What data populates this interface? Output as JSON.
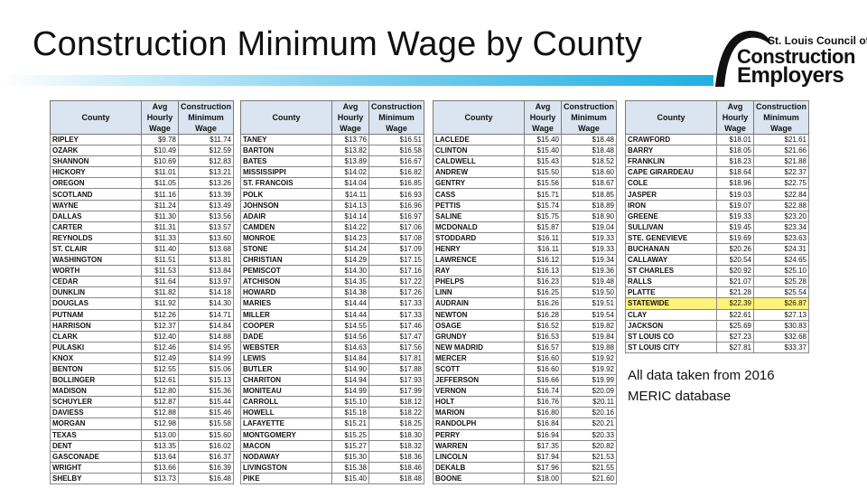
{
  "title": "Construction Minimum Wage by County",
  "logo": {
    "line1": "St. Louis Council of",
    "line2": "Construction",
    "line3": "Employers",
    "icon": "gateway-arch-icon"
  },
  "colors": {
    "band": "#1fb0e3",
    "header_fill": "#dbe5f1",
    "highlight": "#fff27a"
  },
  "table_headers": {
    "county": "County",
    "avg": "Avg Hourly Wage",
    "min": "Construction Minimum Wage"
  },
  "tables": [
    {
      "rows": [
        [
          "RIPLEY",
          "$9.78",
          "$11.74"
        ],
        [
          "OZARK",
          "$10.49",
          "$12.59"
        ],
        [
          "SHANNON",
          "$10.69",
          "$12.83"
        ],
        [
          "HICKORY",
          "$11.01",
          "$13.21"
        ],
        [
          "OREGON",
          "$11.05",
          "$13.26"
        ],
        [
          "SCOTLAND",
          "$11.16",
          "$13.39"
        ],
        [
          "WAYNE",
          "$11.24",
          "$13.49"
        ],
        [
          "DALLAS",
          "$11.30",
          "$13.56"
        ],
        [
          "CARTER",
          "$11.31",
          "$13.57"
        ],
        [
          "REYNOLDS",
          "$11.33",
          "$13.60"
        ],
        [
          "ST. CLAIR",
          "$11.40",
          "$13.68"
        ],
        [
          "WASHINGTON",
          "$11.51",
          "$13.81"
        ],
        [
          "WORTH",
          "$11.53",
          "$13.84"
        ],
        [
          "CEDAR",
          "$11.64",
          "$13.97"
        ],
        [
          "DUNKLIN",
          "$11.82",
          "$14.18"
        ],
        [
          "DOUGLAS",
          "$11.92",
          "$14.30"
        ],
        [
          "PUTNAM",
          "$12.26",
          "$14.71"
        ],
        [
          "HARRISON",
          "$12.37",
          "$14.84"
        ],
        [
          "CLARK",
          "$12.40",
          "$14.88"
        ],
        [
          "PULASKI",
          "$12.46",
          "$14.95"
        ],
        [
          "KNOX",
          "$12.49",
          "$14.99"
        ],
        [
          "BENTON",
          "$12.55",
          "$15.06"
        ],
        [
          "BOLLINGER",
          "$12.61",
          "$15.13"
        ],
        [
          "MADISON",
          "$12.80",
          "$15.36"
        ],
        [
          "SCHUYLER",
          "$12.87",
          "$15.44"
        ],
        [
          "DAVIESS",
          "$12.88",
          "$15.46"
        ],
        [
          "MORGAN",
          "$12.98",
          "$15.58"
        ],
        [
          "TEXAS",
          "$13.00",
          "$15.60"
        ],
        [
          "DENT",
          "$13.35",
          "$16.02"
        ],
        [
          "GASCONADE",
          "$13.64",
          "$16.37"
        ],
        [
          "WRIGHT",
          "$13.66",
          "$16.39"
        ],
        [
          "SHELBY",
          "$13.73",
          "$16.48"
        ]
      ]
    },
    {
      "rows": [
        [
          "TANEY",
          "$13.76",
          "$16.51"
        ],
        [
          "BARTON",
          "$13.82",
          "$16.58"
        ],
        [
          "BATES",
          "$13.89",
          "$16.67"
        ],
        [
          "MISSISSIPPI",
          "$14.02",
          "$16.82"
        ],
        [
          "ST. FRANCOIS",
          "$14.04",
          "$16.85"
        ],
        [
          "POLK",
          "$14.11",
          "$16.93"
        ],
        [
          "JOHNSON",
          "$14.13",
          "$16.96"
        ],
        [
          "ADAIR",
          "$14.14",
          "$16.97"
        ],
        [
          "CAMDEN",
          "$14.22",
          "$17.06"
        ],
        [
          "MONROE",
          "$14.23",
          "$17.08"
        ],
        [
          "STONE",
          "$14.24",
          "$17.09"
        ],
        [
          "CHRISTIAN",
          "$14.29",
          "$17.15"
        ],
        [
          "PEMISCOT",
          "$14.30",
          "$17.16"
        ],
        [
          "ATCHISON",
          "$14.35",
          "$17.22"
        ],
        [
          "HOWARD",
          "$14.38",
          "$17.26"
        ],
        [
          "MARIES",
          "$14.44",
          "$17.33"
        ],
        [
          "MILLER",
          "$14.44",
          "$17.33"
        ],
        [
          "COOPER",
          "$14.55",
          "$17.46"
        ],
        [
          "DADE",
          "$14.56",
          "$17.47"
        ],
        [
          "WEBSTER",
          "$14.63",
          "$17.56"
        ],
        [
          "LEWIS",
          "$14.84",
          "$17.81"
        ],
        [
          "BUTLER",
          "$14.90",
          "$17.88"
        ],
        [
          "CHARITON",
          "$14.94",
          "$17.93"
        ],
        [
          "MONITEAU",
          "$14.99",
          "$17.99"
        ],
        [
          "CARROLL",
          "$15.10",
          "$18.12"
        ],
        [
          "HOWELL",
          "$15.18",
          "$18.22"
        ],
        [
          "LAFAYETTE",
          "$15.21",
          "$18.25"
        ],
        [
          "MONTGOMERY",
          "$15.25",
          "$18.30"
        ],
        [
          "MACON",
          "$15.27",
          "$18.32"
        ],
        [
          "NODAWAY",
          "$15.30",
          "$18.36"
        ],
        [
          "LIVINGSTON",
          "$15.38",
          "$18.46"
        ],
        [
          "PIKE",
          "$15.40",
          "$18.48"
        ]
      ]
    },
    {
      "rows": [
        [
          "LACLEDE",
          "$15.40",
          "$18.48"
        ],
        [
          "CLINTON",
          "$15.40",
          "$18.48"
        ],
        [
          "CALDWELL",
          "$15.43",
          "$18.52"
        ],
        [
          "ANDREW",
          "$15.50",
          "$18.60"
        ],
        [
          "GENTRY",
          "$15.56",
          "$18.67"
        ],
        [
          "CASS",
          "$15.71",
          "$18.85"
        ],
        [
          "PETTIS",
          "$15.74",
          "$18.89"
        ],
        [
          "SALINE",
          "$15.75",
          "$18.90"
        ],
        [
          "MCDONALD",
          "$15.87",
          "$19.04"
        ],
        [
          "STODDARD",
          "$16.11",
          "$19.33"
        ],
        [
          "HENRY",
          "$16.11",
          "$19.33"
        ],
        [
          "LAWRENCE",
          "$16.12",
          "$19.34"
        ],
        [
          "RAY",
          "$16.13",
          "$19.36"
        ],
        [
          "PHELPS",
          "$16.23",
          "$19.48"
        ],
        [
          "LINN",
          "$16.25",
          "$19.50"
        ],
        [
          "AUDRAIN",
          "$16.26",
          "$19.51"
        ],
        [
          "NEWTON",
          "$16.28",
          "$19.54"
        ],
        [
          "OSAGE",
          "$16.52",
          "$19.82"
        ],
        [
          "GRUNDY",
          "$16.53",
          "$19.84"
        ],
        [
          "NEW MADRID",
          "$16.57",
          "$19.88"
        ],
        [
          "MERCER",
          "$16.60",
          "$19.92"
        ],
        [
          "SCOTT",
          "$16.60",
          "$19.92"
        ],
        [
          "JEFFERSON",
          "$16.66",
          "$19.99"
        ],
        [
          "VERNON",
          "$16.74",
          "$20.09"
        ],
        [
          "HOLT",
          "$16.76",
          "$20.11"
        ],
        [
          "MARION",
          "$16.80",
          "$20.16"
        ],
        [
          "RANDOLPH",
          "$16.84",
          "$20.21"
        ],
        [
          "PERRY",
          "$16.94",
          "$20.33"
        ],
        [
          "WARREN",
          "$17.35",
          "$20.82"
        ],
        [
          "LINCOLN",
          "$17.94",
          "$21.53"
        ],
        [
          "DEKALB",
          "$17.96",
          "$21.55"
        ],
        [
          "BOONE",
          "$18.00",
          "$21.60"
        ]
      ]
    },
    {
      "rows": [
        [
          "CRAWFORD",
          "$18.01",
          "$21.61"
        ],
        [
          "BARRY",
          "$18.05",
          "$21.66"
        ],
        [
          "FRANKLIN",
          "$18.23",
          "$21.88"
        ],
        [
          "CAPE GIRARDEAU",
          "$18.64",
          "$22.37"
        ],
        [
          "COLE",
          "$18.96",
          "$22.75"
        ],
        [
          "JASPER",
          "$19.03",
          "$22.84"
        ],
        [
          "IRON",
          "$19.07",
          "$22.88"
        ],
        [
          "GREENE",
          "$19.33",
          "$23.20"
        ],
        [
          "SULLIVAN",
          "$19.45",
          "$23.34"
        ],
        [
          "STE. GENEVIEVE",
          "$19.69",
          "$23.63"
        ],
        [
          "BUCHANAN",
          "$20.26",
          "$24.31"
        ],
        [
          "CALLAWAY",
          "$20.54",
          "$24.65"
        ],
        [
          "ST CHARLES",
          "$20.92",
          "$25.10"
        ],
        [
          "RALLS",
          "$21.07",
          "$25.28"
        ],
        [
          "PLATTE",
          "$21.28",
          "$25.54"
        ],
        [
          "STATEWIDE",
          "$22.39",
          "$26.87"
        ],
        [
          "CLAY",
          "$22.61",
          "$27.13"
        ],
        [
          "JACKSON",
          "$25.69",
          "$30.83"
        ],
        [
          "ST LOUIS CO",
          "$27.23",
          "$32.68"
        ],
        [
          "ST LOUIS CITY",
          "$27.81",
          "$33.37"
        ]
      ],
      "highlight_row": "STATEWIDE"
    }
  ],
  "note": "All data taken from 2016 MERIC database"
}
